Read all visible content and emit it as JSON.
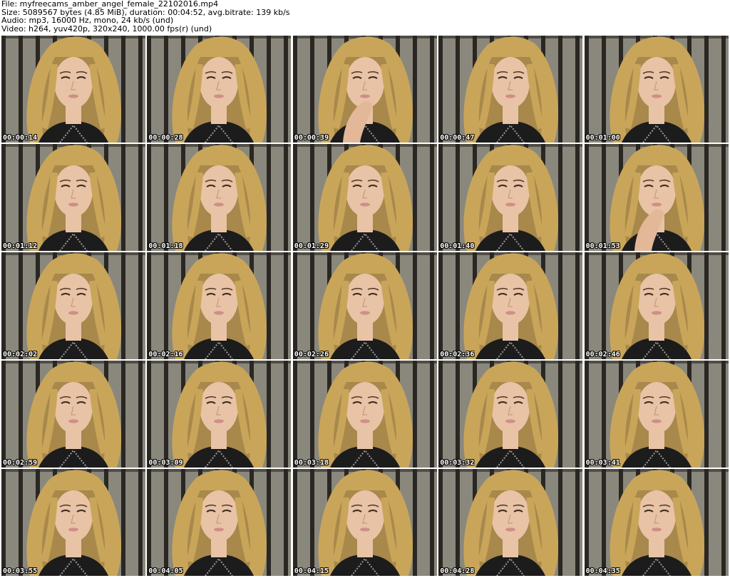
{
  "header": {
    "file": "File: myfreecams_amber_angel_female_22102016.mp4",
    "size": "Size: 5089567 bytes (4.85 MiB), duration: 00:04:52, avg.bitrate: 139 kb/s",
    "audio": "Audio: mp3, 16000 Hz, mono, 24 kb/s (und)",
    "video": "Video: h264, yuv420p, 320x240, 1000.00 fps(r) (und)"
  },
  "thumbnails": [
    {
      "time": "00:00:14",
      "pose": "neutral"
    },
    {
      "time": "00:00:28",
      "pose": "neutral"
    },
    {
      "time": "00:00:39",
      "pose": "hand-face"
    },
    {
      "time": "00:00:47",
      "pose": "neutral"
    },
    {
      "time": "00:01:00",
      "pose": "neutral"
    },
    {
      "time": "00:01:12",
      "pose": "neutral"
    },
    {
      "time": "00:01:18",
      "pose": "neutral"
    },
    {
      "time": "00:01:29",
      "pose": "neutral"
    },
    {
      "time": "00:01:40",
      "pose": "neutral"
    },
    {
      "time": "00:01:53",
      "pose": "hand-face"
    },
    {
      "time": "00:02:02",
      "pose": "neutral"
    },
    {
      "time": "00:02:16",
      "pose": "neutral"
    },
    {
      "time": "00:02:26",
      "pose": "neutral"
    },
    {
      "time": "00:02:36",
      "pose": "neutral"
    },
    {
      "time": "00:02:46",
      "pose": "neutral"
    },
    {
      "time": "00:02:59",
      "pose": "neutral"
    },
    {
      "time": "00:03:09",
      "pose": "neutral"
    },
    {
      "time": "00:03:18",
      "pose": "neutral"
    },
    {
      "time": "00:03:32",
      "pose": "neutral"
    },
    {
      "time": "00:03:41",
      "pose": "neutral"
    },
    {
      "time": "00:03:55",
      "pose": "neutral"
    },
    {
      "time": "00:04:05",
      "pose": "neutral"
    },
    {
      "time": "00:04:15",
      "pose": "neutral"
    },
    {
      "time": "00:04:28",
      "pose": "neutral"
    },
    {
      "time": "00:04:35",
      "pose": "neutral"
    }
  ],
  "colors": {
    "background": "#ffffff",
    "screen_dark": "#2a2723",
    "screen_light": "#8a887c",
    "hair": "#c9a55a",
    "hair_dark": "#6b5430",
    "skin": "#e9c3a6",
    "top": "#1c1c1c"
  }
}
